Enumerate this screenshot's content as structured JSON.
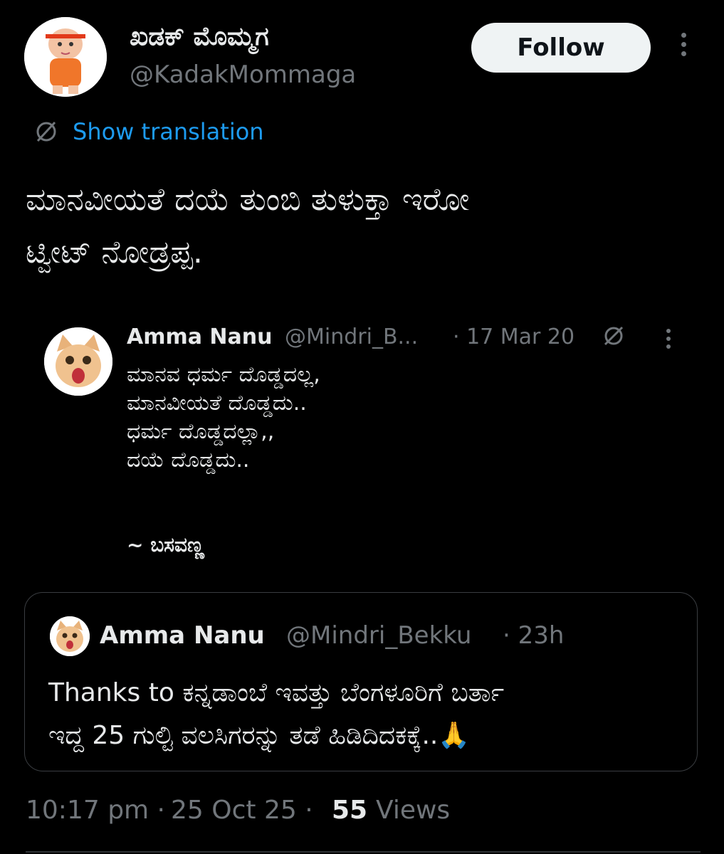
{
  "tweet": {
    "author": {
      "display_name": "ಖಡಕ್ ಮೊಮ್ಮಗ",
      "handle": "@KadakMommaga"
    },
    "follow_label": "Follow",
    "show_translation": "Show translation",
    "text": "ಮಾನವೀಯತೆ ದಯೆ ತುಂಬಿ ತುಳುಕ್ತಾ ಇರೋ\nಟ್ವೀಟ್ ನೋಡ್ರಪ್ಪ.",
    "embedded_image": {
      "name": "Amma Nanu",
      "handle": "@Mindri_B...",
      "date": "· 17 Mar 20",
      "poem": "ಮಾನವ ಧರ್ಮ ದೊಡ್ಡದಲ್ಲ,\nಮಾನವೀಯತೆ ದೊಡ್ಡದು..\nಧರ್ಮ ದೊಡ್ಡದಲ್ಲಾ,,\nದಯೆ ದೊಡ್ಡದು..",
      "signature": "~ ಬಸವಣ್ಣ"
    },
    "quote": {
      "name": "Amma Nanu",
      "handle": "@Mindri_Bekku",
      "time": "· 23h",
      "text": "Thanks to ಕನ್ನಡಾಂಬೆ ಇವತ್ತು ಬೆಂಗಳೂರಿಗೆ ಬರ್ತಾ\nಇದ್ದ 25 ಗುಲ್ಟಿ ವಲಸಿಗರನ್ನು ತಡೆ ಹಿಡಿದಿದಕಕ್ಕೆ..🙏"
    },
    "meta": {
      "time": "10:17 pm ·",
      "date": "25 Oct 25 ·",
      "views_count": "55",
      "views_label": "Views"
    }
  },
  "colors": {
    "background": "#000000",
    "text": "#e7e9ea",
    "muted": "#71767b",
    "link": "#1d9bf0",
    "follow_bg": "#eff3f4",
    "border": "#2f3336"
  },
  "icons": [
    "translate-icon",
    "more-options-icon",
    "boss-baby-avatar",
    "cat-avatar"
  ]
}
